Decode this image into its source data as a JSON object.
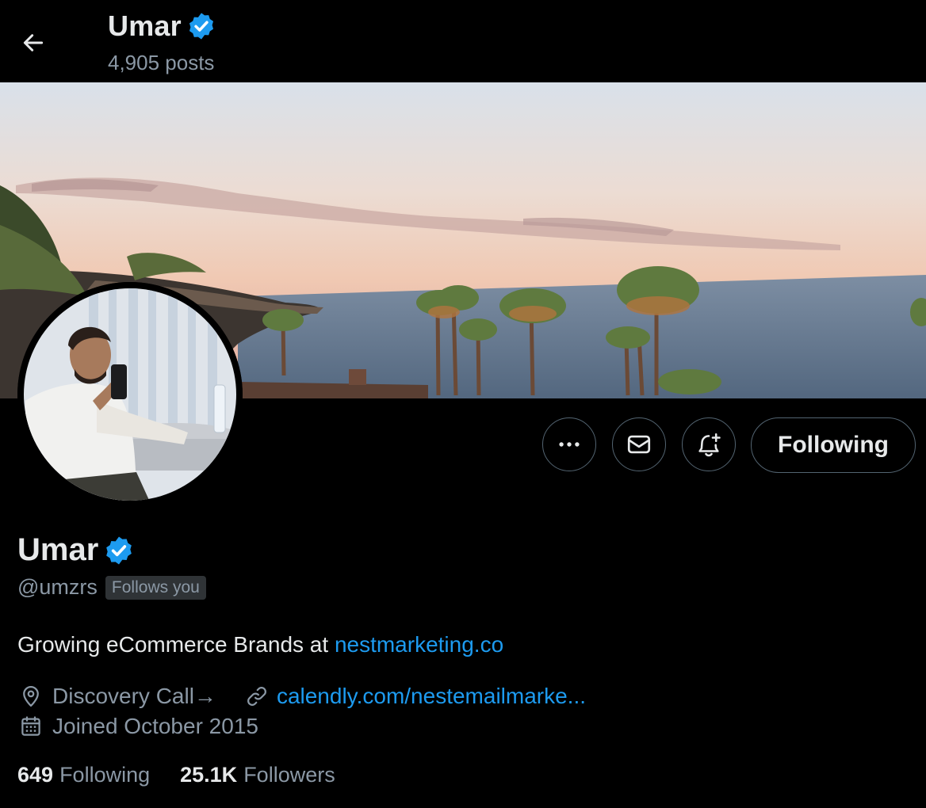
{
  "header": {
    "name": "Umar",
    "posts": "4,905 posts"
  },
  "profile": {
    "name": "Umar",
    "handle": "@umzrs",
    "follows_you": "Follows you",
    "bio_text": "Growing eCommerce Brands at ",
    "bio_link": "nestmarketing.co",
    "location": "Discovery Call→",
    "website": "calendly.com/nestemailmarke...",
    "joined": "Joined October 2015"
  },
  "actions": {
    "following_label": "Following"
  },
  "stats": {
    "following_count": "649",
    "following_label": "Following",
    "followers_count": "25.1K",
    "followers_label": "Followers"
  },
  "icons": {
    "back": "arrow-left-icon",
    "verified": "verified-badge-icon",
    "more": "more-icon",
    "message": "mail-icon",
    "notify": "bell-plus-icon",
    "location": "location-pin-icon",
    "link": "link-icon",
    "calendar": "calendar-icon"
  },
  "colors": {
    "background": "#000000",
    "text_primary": "#e7e9ea",
    "text_secondary": "#8b98a5",
    "accent": "#1d9bf0"
  }
}
